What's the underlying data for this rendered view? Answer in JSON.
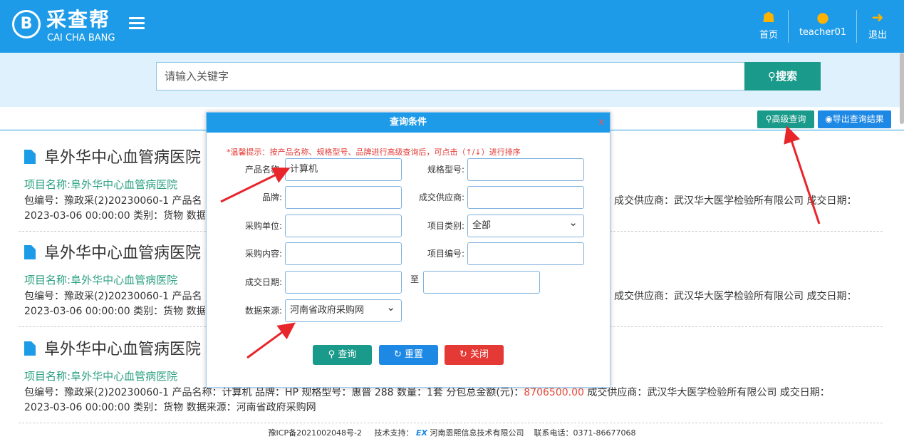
{
  "header": {
    "logo_cn": "采查帮",
    "logo_en": "CAI CHA BANG",
    "nav": [
      {
        "label": "首页",
        "icon": "home-icon"
      },
      {
        "label": "teacher01",
        "icon": "user-icon"
      },
      {
        "label": "退出",
        "icon": "logout-icon"
      }
    ]
  },
  "search": {
    "placeholder": "请输入关键字",
    "button_label": "搜索"
  },
  "toolbar": {
    "advanced_label": "高级查询",
    "export_label": "导出查询结果"
  },
  "results": [
    {
      "title": "阜外华中心血管病医院",
      "project_label": "项目名称:",
      "project_value": "阜外华中心血管病医院",
      "info_left": "包编号：豫政采(2)20230060-1  产品名",
      "info_right": "成交供应商：武汉华大医学检验所有限公司  成交日期：",
      "info_line2": "2023-03-06 00:00:00  类别：货物  数据"
    },
    {
      "title": "阜外华中心血管病医院",
      "project_label": "项目名称:",
      "project_value": "阜外华中心血管病医院",
      "info_left": "包编号：豫政采(2)20230060-1  产品名",
      "info_right": "成交供应商：武汉华大医学检验所有限公司  成交日期：",
      "info_line2": "2023-03-06 00:00:00  类别：货物  数据"
    },
    {
      "title": "阜外华中心血管病医院",
      "project_label": "项目名称:",
      "project_value": "阜外华中心血管病医院",
      "info_full_a": "包编号：豫政采(2)20230060-1  产品名称：计算机  品牌：HP  规格型号：惠普 288  数量：1套  分包总金额(元)：",
      "info_money": "8706500.00",
      "info_full_b": "  成交供应商：武汉华大医学检验所有限公司  成交日期：",
      "info_line2": "2023-03-06 00:00:00  类别：货物  数据来源：河南省政府采购网"
    }
  ],
  "footer": {
    "icp": "豫ICP备2021002048号-2",
    "support_label": "技术支持：",
    "logo": "EX",
    "company": "河南恩熙信息技术有限公司",
    "phone": "联系电话：0371-86677068"
  },
  "modal": {
    "title": "查询条件",
    "close": "x",
    "tip": "*温馨提示：按产品名称、规格型号、品牌进行高级查询后，可点击（↑/↓）进行排序",
    "fields": {
      "product_name": {
        "label": "产品名称:",
        "value": "计算机"
      },
      "spec_model": {
        "label": "规格型号:",
        "value": ""
      },
      "brand": {
        "label": "品牌:",
        "value": ""
      },
      "supplier": {
        "label": "成交供应商:",
        "value": ""
      },
      "purchaser": {
        "label": "采购单位:",
        "value": ""
      },
      "project_type": {
        "label": "项目类别:",
        "value": "全部"
      },
      "content": {
        "label": "采购内容:",
        "value": ""
      },
      "project_no": {
        "label": "项目编号:",
        "value": ""
      },
      "date": {
        "label": "成交日期:",
        "from": "",
        "to_label": "至",
        "to": ""
      },
      "source": {
        "label": "数据来源:",
        "value": "河南省政府采购网"
      }
    },
    "buttons": {
      "query": "查询",
      "reset": "重置",
      "close": "关闭"
    }
  },
  "colors": {
    "brand": "#1e9be8",
    "teal": "#1a9a8a",
    "blue": "#1e88e5",
    "red": "#e53935",
    "arrow": "#e8252b"
  }
}
